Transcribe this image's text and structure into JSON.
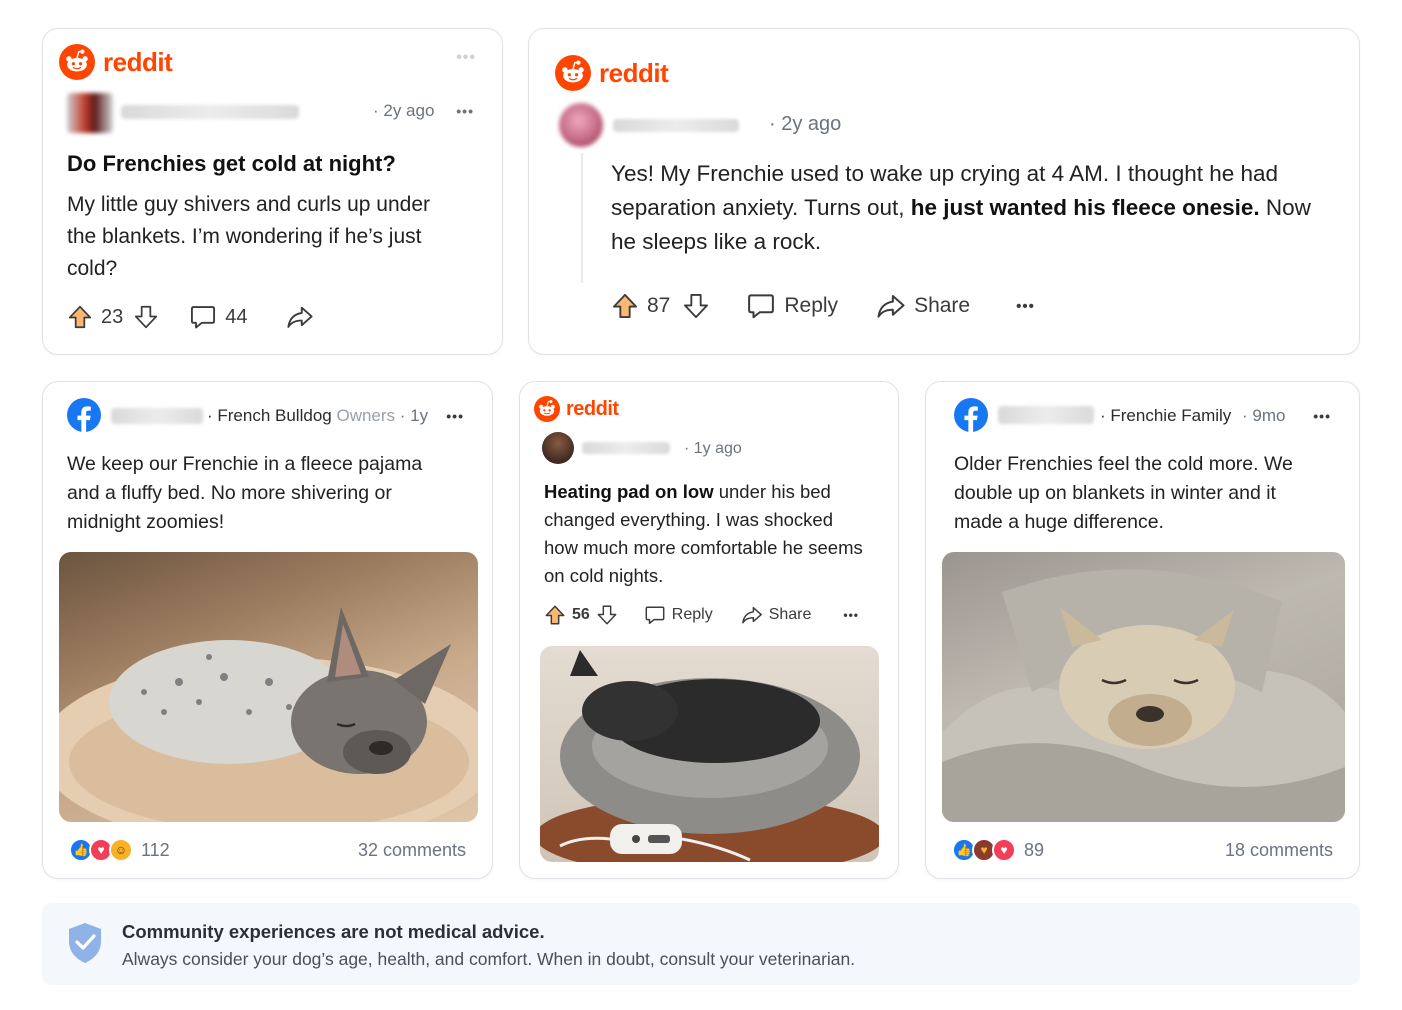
{
  "colors": {
    "reddit_orange": "#ff4500",
    "facebook_blue": "#1877f2",
    "card_border": "#dfe3e8",
    "notice_bg": "#f4f7fb",
    "shield_blue": "#8fb3e6"
  },
  "card1": {
    "brand": "reddit",
    "time": "· 2y ago",
    "title": "Do Frenchies get cold at night?",
    "body": "My little guy shivers and curls up under the blankets. I’m wondering if he’s just cold?",
    "upvotes": "23",
    "comments": "44",
    "icons": [
      "upvote-icon",
      "downvote-icon",
      "comment-icon",
      "share-icon"
    ]
  },
  "card2": {
    "brand": "reddit",
    "time": "· 2y ago",
    "body_pre": "Yes! My Frenchie used to wake up crying at 4 AM. I thought he had separation anxiety. Turns out, ",
    "body_bold": "he just wanted his fleece onesie.",
    "body_post": " Now he sleeps like a rock.",
    "upvotes": "87",
    "reply_label": "Reply",
    "share_label": "Share"
  },
  "card3": {
    "brand": "facebook",
    "group": "· French Bulldog",
    "group_suffix": "Owners",
    "time": "· 1y",
    "body": "We keep our Frenchie in a fleece pajama and a fluffy bed. No more shivering or midnight zoomies!",
    "image": "french-bulldog-in-fleece-pajama-on-fluffy-bed",
    "reactions": [
      "like",
      "love",
      "haha"
    ],
    "reaction_count": "112",
    "comments": "32 comments"
  },
  "card4": {
    "brand": "reddit",
    "time": "· 1y ago",
    "body_bold": "Heating pad on low",
    "body_rest": " under his bed changed everything. I was shocked how much more comfortable he seems on cold nights.",
    "upvotes": "56",
    "reply_label": "Reply",
    "share_label": "Share",
    "image": "french-bulldog-sleeping-in-round-bed-with-heating-pad"
  },
  "card5": {
    "brand": "facebook",
    "group": "· Frenchie Family",
    "time": "· 9mo",
    "body": "Older Frenchies feel the cold more. We double up on blankets in winter and it made a huge difference.",
    "image": "french-bulldog-wrapped-in-blanket",
    "reactions": [
      "like",
      "care",
      "love"
    ],
    "reaction_count": "89",
    "comments": "18 comments"
  },
  "notice": {
    "title": "Community experiences are not medical advice.",
    "text": "Always consider your dog’s age, health, and comfort. When in doubt, consult your veterinarian."
  }
}
